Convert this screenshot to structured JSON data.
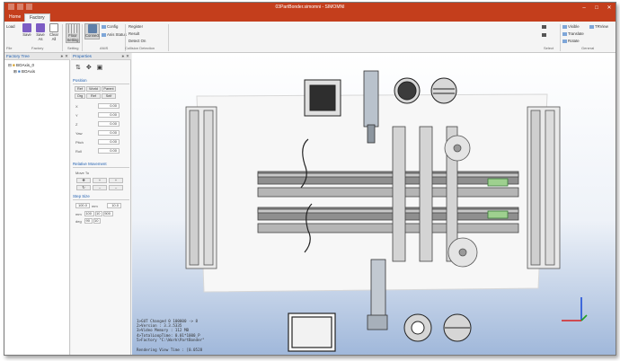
{
  "window": {
    "title": "03PartBonder.simomni - SIMOMNI",
    "tabs": [
      "Home",
      "Factory"
    ],
    "active_tab": "Factory"
  },
  "ribbon": {
    "load": "Load",
    "file": {
      "save": "Save",
      "save_as": "Save As",
      "clear_all": "Clear All",
      "group": "File"
    },
    "factory": {
      "group": "Factory"
    },
    "setting": {
      "floor_setting": "Floor Setting",
      "group": "Setting"
    },
    "anis": {
      "connect": "Connect",
      "config": "Config",
      "anis_status": "Anis Status",
      "group": "ANIS"
    },
    "collision": {
      "register": "Register",
      "result": "Result",
      "detect_on": "Detect On",
      "group": "Collision Detection"
    },
    "select": {
      "group": "Select"
    },
    "general": {
      "visible": "Visible",
      "translate": "Translate",
      "rotate": "Rotate",
      "tr_view": "TRView",
      "group": "General"
    }
  },
  "factory_tree": {
    "title": "Factory Tree",
    "items": [
      {
        "label": "BOAxis_0"
      },
      {
        "label": "BOAxis"
      }
    ]
  },
  "properties": {
    "title": "Properties",
    "tabs": [
      "Ref",
      "World",
      "Parent",
      "Org",
      "Ref",
      "Self"
    ],
    "position_title": "Position",
    "fields": [
      {
        "label": "X",
        "value": "0.00"
      },
      {
        "label": "Y",
        "value": "0.00"
      },
      {
        "label": "Z",
        "value": "0.00"
      },
      {
        "label": "Yaw",
        "value": "0.00"
      },
      {
        "label": "Pitch",
        "value": "0.00"
      },
      {
        "label": "Roll",
        "value": "0.00"
      }
    ],
    "relative_title": "Relative Movement",
    "move_to": "Move To",
    "step_title": "Step Size",
    "step_value": "100.0",
    "step_unit": "mm",
    "step_deg_value": "10.0",
    "step_rows": [
      {
        "label": "mm",
        "a": "100",
        "b": "10",
        "c": "500"
      },
      {
        "label": "deg",
        "a": "90",
        "b": "10",
        "c": ""
      }
    ]
  },
  "viewport": {
    "info_lines": [
      "1>GUT Changed 0 100000 -> 8",
      "2>Version : 3.3.5335",
      "3>Video Memory : 112 MB",
      "4>TotalLoopTime: 0.01*1000_P",
      "5>Factory \"C:\\Work\\PartBonder\""
    ],
    "render_time": "Rendering View Time : [0.0528"
  }
}
